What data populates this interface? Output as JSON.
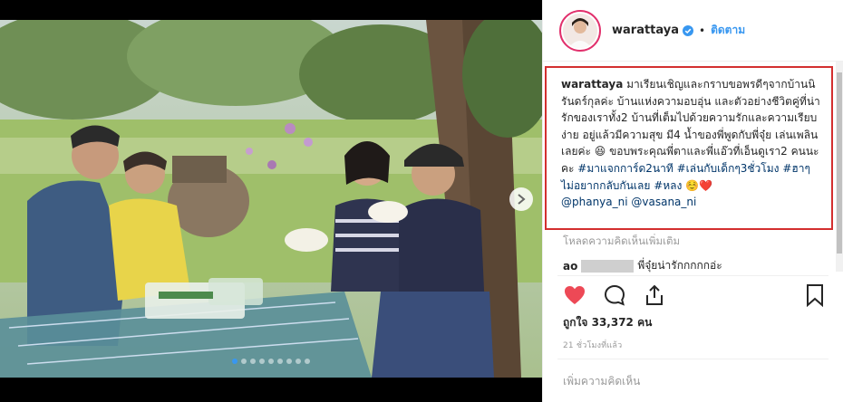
{
  "post": {
    "username": "warattaya",
    "separator": "•",
    "follow_label": "ติดตาม",
    "caption": {
      "user": "warattaya",
      "text": " มาเรียนเชิญและกราบขอพรดีๆจากบ้านนิรันดร์กุลค่ะ บ้านแห่งความอบอุ่น และตัวอย่างชีวิตคู่ที่น่ารักของเราทั้ง2 บ้านที่เต็มไปด้วยความรักและความเรียบง่าย อยู่แล้วมีความสุข มี4 น้ำของพี่พูดกับพี่จุ๋ย เล่นเพลินเลยค่ะ 😆 ขอบพระคุณพี่ตาและพี่แอ๊วที่เอ็นดูเรา2 คนนะคะ ",
      "hashtags": "#มาแจกการ์ด2นาที #เล่นกับเด็กๆ3ชั่วโมง #ฮาๆไม่อยากกลับกันเลย #หลง",
      "emoji_tail": " ☺️❤️",
      "mentions": "@phanya_ni @vasana_ni"
    },
    "load_more": "โหลดความคิดเห็นเพิ่มเติม",
    "comment": {
      "user": "ao",
      "text": "พี่จุ๋ยน่ารักกกกกอ่ะ"
    },
    "likes_text": "ถูกใจ 33,372 คน",
    "time_ago": "21 ชั่วโมงที่แล้ว",
    "add_comment_placeholder": "เพิ่มความคิดเห็น"
  },
  "carousel": {
    "count": 9,
    "active_index": 0
  },
  "colors": {
    "accent": "#3897f0",
    "like_red": "#ed4956",
    "highlight": "#d32f2f"
  }
}
